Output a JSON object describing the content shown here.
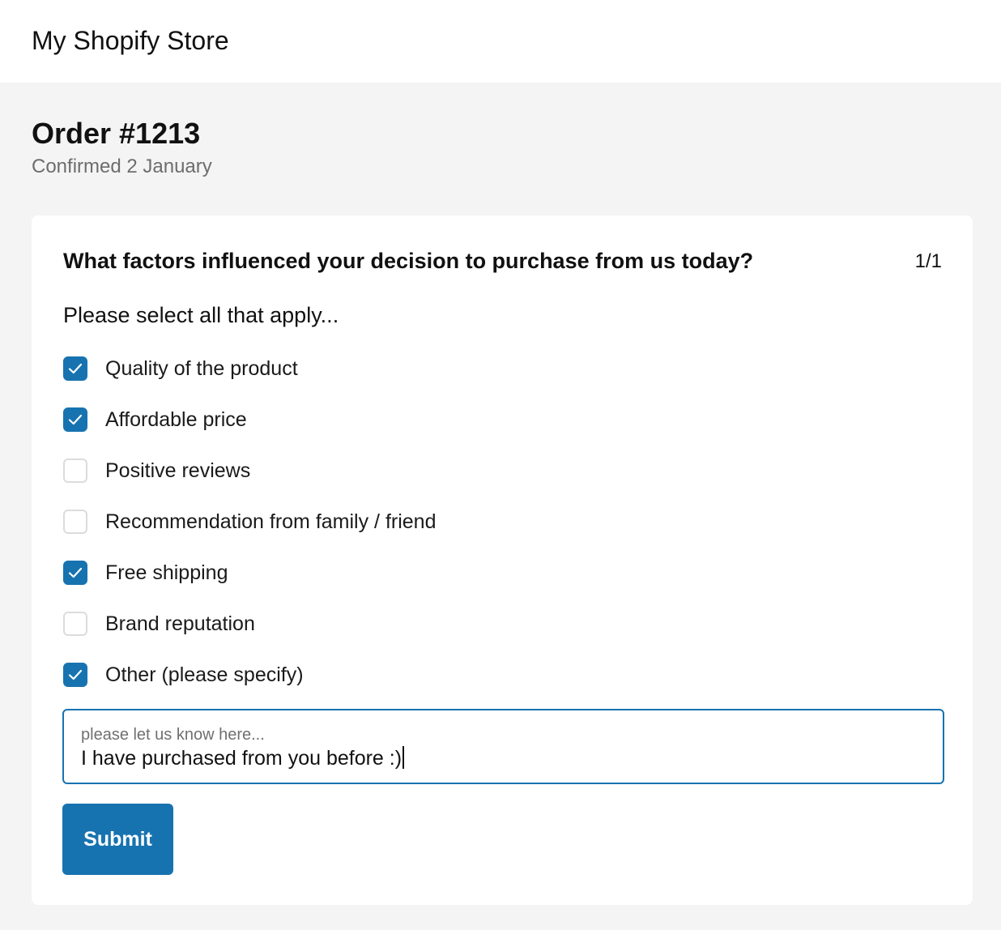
{
  "header": {
    "store_name": "My Shopify Store"
  },
  "order": {
    "title": "Order #1213",
    "subtitle": "Confirmed 2 January"
  },
  "survey": {
    "question": "What factors influenced your decision to purchase from us today?",
    "counter": "1/1",
    "prompt": "Please select all that apply...",
    "options": [
      {
        "label": "Quality of the product",
        "checked": true
      },
      {
        "label": "Affordable price",
        "checked": true
      },
      {
        "label": "Positive reviews",
        "checked": false
      },
      {
        "label": "Recommendation from family / friend",
        "checked": false
      },
      {
        "label": "Free shipping",
        "checked": true
      },
      {
        "label": "Brand reputation",
        "checked": false
      },
      {
        "label": "Other (please specify)",
        "checked": true
      }
    ],
    "other_field": {
      "placeholder": "please let us know here...",
      "value": "I have purchased from you before :)"
    },
    "submit_label": "Submit"
  },
  "colors": {
    "accent": "#1773b0",
    "page_background": "#f4f4f4",
    "card_background": "#ffffff",
    "muted_text": "#6d6d6d"
  },
  "icons": {
    "checkbox_checked": "checkmark-icon"
  }
}
